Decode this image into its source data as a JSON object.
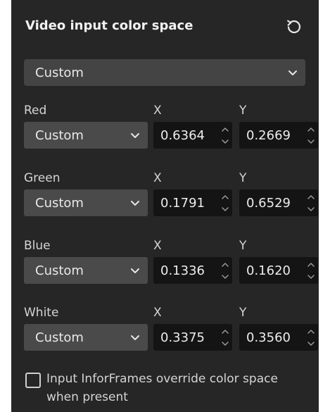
{
  "panel": {
    "title": "Video input color space",
    "reset_icon": "reset-undo-icon"
  },
  "preset": {
    "value": "Custom"
  },
  "columns": {
    "x_label": "X",
    "y_label": "Y"
  },
  "primaries": [
    {
      "label": "Red",
      "mode": "Custom",
      "x": "0.6364",
      "y": "0.2669"
    },
    {
      "label": "Green",
      "mode": "Custom",
      "x": "0.1791",
      "y": "0.6529"
    },
    {
      "label": "Blue",
      "mode": "Custom",
      "x": "0.1336",
      "y": "0.1620"
    },
    {
      "label": "White",
      "mode": "Custom",
      "x": "0.3375",
      "y": "0.3560"
    }
  ],
  "override": {
    "checked": false,
    "label": "Input InforFrames override color space when present"
  },
  "icons": {
    "dropdown": "chevron-down-icon",
    "spinner_up": "chevron-up-icon",
    "spinner_down": "chevron-down-icon"
  }
}
